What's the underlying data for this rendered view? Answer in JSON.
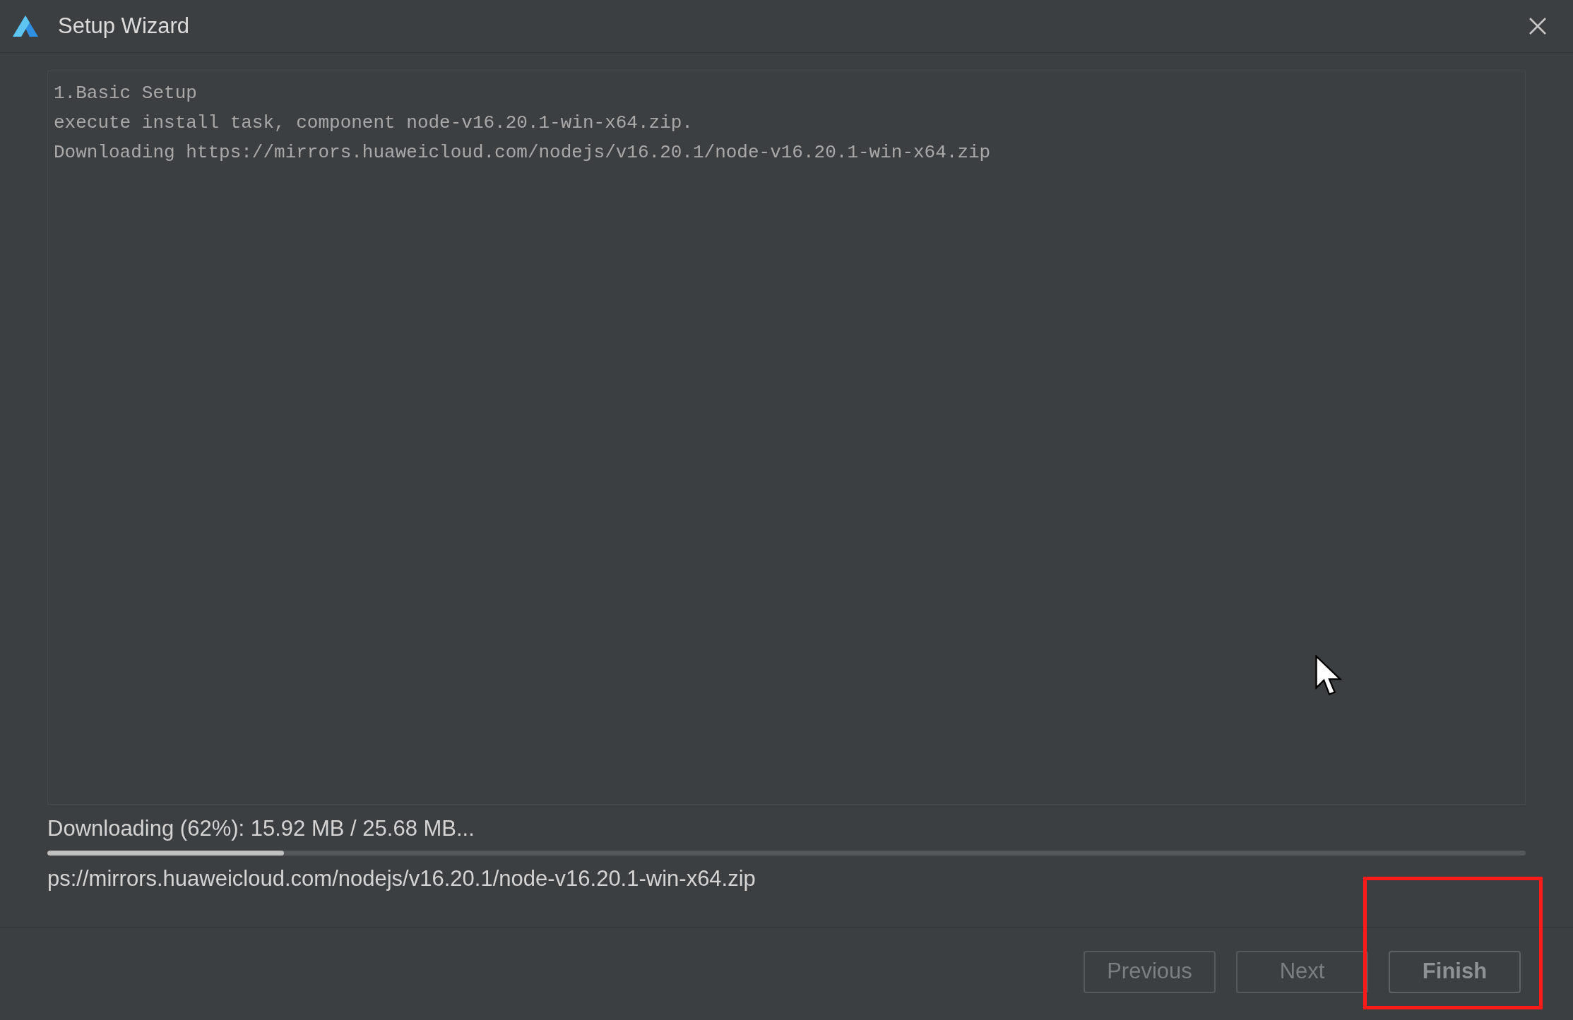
{
  "window": {
    "title": "Setup Wizard"
  },
  "log": [
    "1.Basic Setup",
    "execute install task, component node-v16.20.1-win-x64.zip.",
    "Downloading https://mirrors.huaweicloud.com/nodejs/v16.20.1/node-v16.20.1-win-x64.zip"
  ],
  "progress": {
    "status": "Downloading (62%): 15.92 MB / 25.68 MB...",
    "level": 0.16,
    "detail": "ps://mirrors.huaweicloud.com/nodejs/v16.20.1/node-v16.20.1-win-x64.zip"
  },
  "buttons": [
    {
      "label": "Previous",
      "disabled": true
    },
    {
      "label": "Next",
      "disabled": true
    },
    {
      "label": "Finish",
      "disabled": false
    }
  ]
}
